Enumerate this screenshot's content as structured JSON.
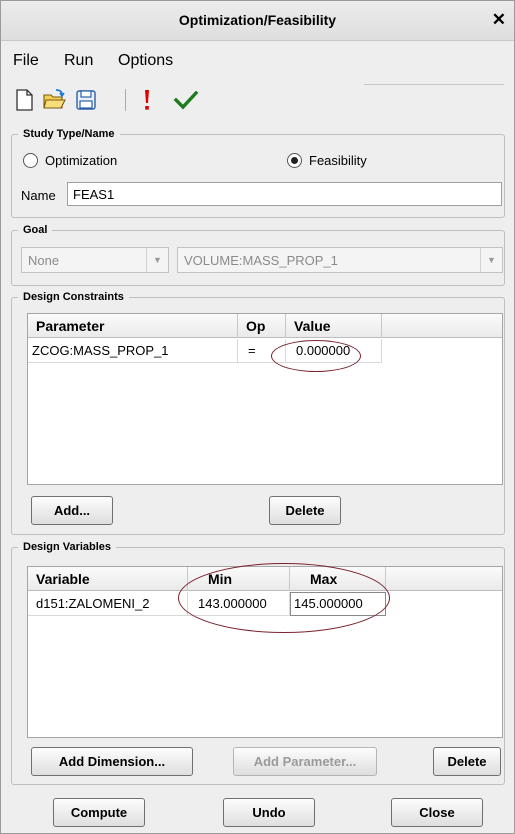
{
  "window": {
    "title": "Optimization/Feasibility",
    "close_glyph": "✕"
  },
  "menu": {
    "file": "File",
    "run": "Run",
    "options": "Options"
  },
  "toolbar": {
    "icons": [
      "new-file-icon",
      "open-folder-icon",
      "save-icon",
      "run-exclamation-icon",
      "checkmark-icon"
    ],
    "accent_red": "#e00000",
    "accent_green": "#1e7b1e"
  },
  "study": {
    "legend": "Study Type/Name",
    "optimization_label": "Optimization",
    "feasibility_label": "Feasibility",
    "selected": "Feasibility",
    "name_label": "Name",
    "name_value": "FEAS1"
  },
  "goal": {
    "legend": "Goal",
    "type_value": "None",
    "target_value": "VOLUME:MASS_PROP_1"
  },
  "constraints": {
    "legend": "Design Constraints",
    "columns": [
      "Parameter",
      "Op",
      "Value"
    ],
    "rows": [
      {
        "parameter": "ZCOG:MASS_PROP_1",
        "op": "=",
        "value": "0.000000"
      }
    ],
    "add_label": "Add...",
    "delete_label": "Delete"
  },
  "variables": {
    "legend": "Design Variables",
    "columns": [
      "Variable",
      "Min",
      "Max"
    ],
    "rows": [
      {
        "variable": "d151:ZALOMENI_2",
        "min": "143.000000",
        "max": "145.000000"
      }
    ],
    "add_dimension_label": "Add Dimension...",
    "add_parameter_label": "Add Parameter...",
    "delete_label": "Delete"
  },
  "footer": {
    "compute_label": "Compute",
    "undo_label": "Undo",
    "close_label": "Close"
  }
}
